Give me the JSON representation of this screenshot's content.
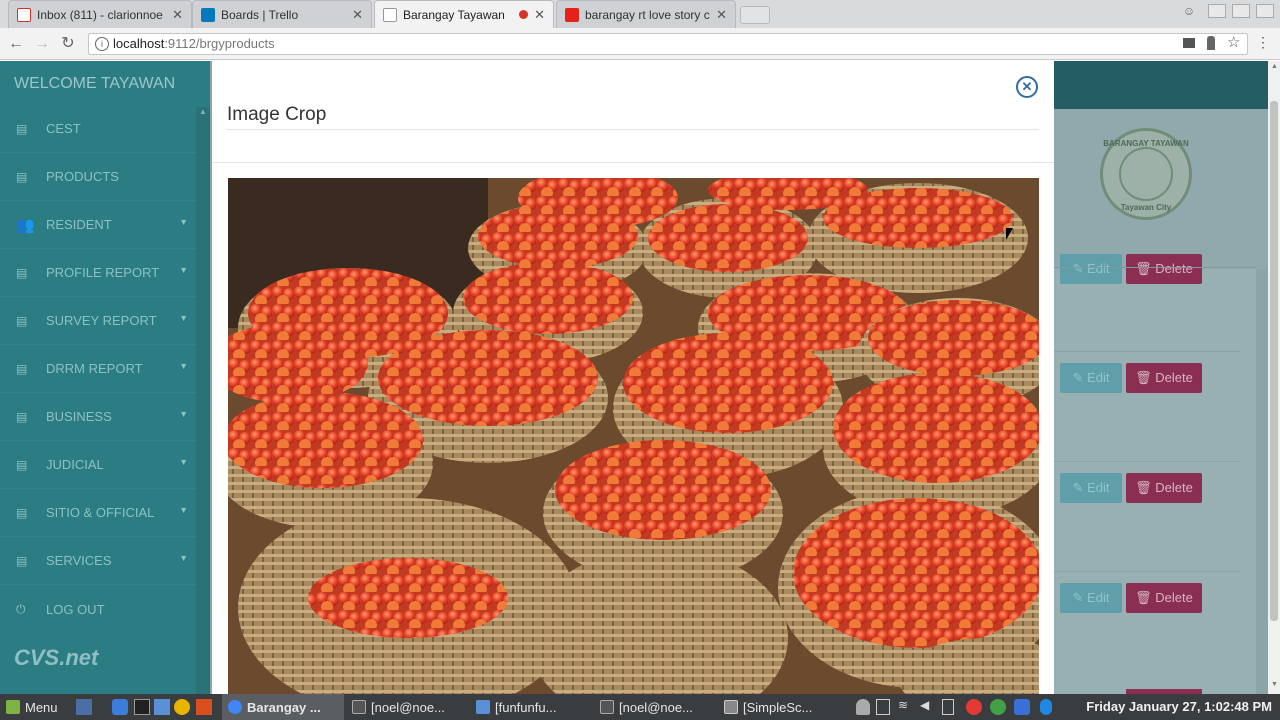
{
  "browser": {
    "tabs": [
      {
        "label": "Inbox (811) - clarionnoe",
        "icon": "gmail-icon",
        "icon_color": "#d93025"
      },
      {
        "label": "Boards | Trello",
        "icon": "trello-icon",
        "icon_color": "#0079bf"
      },
      {
        "label": "Barangay Tayawan",
        "icon": "page-icon",
        "icon_color": "#999999",
        "recording": true
      },
      {
        "label": "barangay rt love story c",
        "icon": "youtube-icon",
        "icon_color": "#e62117"
      }
    ],
    "close_glyph": "✕",
    "url_host": "localhost",
    "url_path": ":9112/brgyproducts"
  },
  "sidebar": {
    "title": "WELCOME TAYAWAN",
    "items": [
      {
        "label": "CEST",
        "icon": "list-icon",
        "has_submenu": false
      },
      {
        "label": "PRODUCTS",
        "icon": "list-icon",
        "has_submenu": false
      },
      {
        "label": "RESIDENT",
        "icon": "users-icon",
        "has_submenu": true
      },
      {
        "label": "PROFILE REPORT",
        "icon": "list-icon",
        "has_submenu": true
      },
      {
        "label": "SURVEY REPORT",
        "icon": "list-icon",
        "has_submenu": true
      },
      {
        "label": "DRRM REPORT",
        "icon": "list-icon",
        "has_submenu": true
      },
      {
        "label": "BUSINESS",
        "icon": "list-icon",
        "has_submenu": true
      },
      {
        "label": "JUDICIAL",
        "icon": "list-icon",
        "has_submenu": true
      },
      {
        "label": "SITIO & OFFICIAL",
        "icon": "list-icon",
        "has_submenu": true
      },
      {
        "label": "SERVICES",
        "icon": "list-icon",
        "has_submenu": true
      },
      {
        "label": "LOG OUT",
        "icon": "power-icon",
        "has_submenu": false
      }
    ],
    "brand": "CVS.net"
  },
  "seal": {
    "top_text": "BARANGAY TAYAWAN",
    "bottom_text": "Tayawan City"
  },
  "rows": [
    {
      "edit": "Edit",
      "delete": "Delete"
    },
    {
      "edit": "Edit",
      "delete": "Delete"
    },
    {
      "edit": "Edit",
      "delete": "Delete"
    },
    {
      "edit": "Edit",
      "delete": "Delete"
    }
  ],
  "modal": {
    "title": "Image Crop",
    "close_icon": "close-circle-icon",
    "image_subject": "baskets of tomatoes"
  },
  "taskbar": {
    "menu": "Menu",
    "windows": [
      {
        "label": "Barangay ...",
        "active": true,
        "color": "#4285f4"
      },
      {
        "label": "[noel@noe...",
        "active": false,
        "color": "#555555"
      },
      {
        "label": "[funfunfu...",
        "active": false,
        "color": "#5b8fd6"
      },
      {
        "label": "[noel@noe...",
        "active": false,
        "color": "#555555"
      },
      {
        "label": "[SimpleSc...",
        "active": false,
        "color": "#888888"
      }
    ],
    "clock": "Friday January 27,  1:02:48 PM"
  }
}
